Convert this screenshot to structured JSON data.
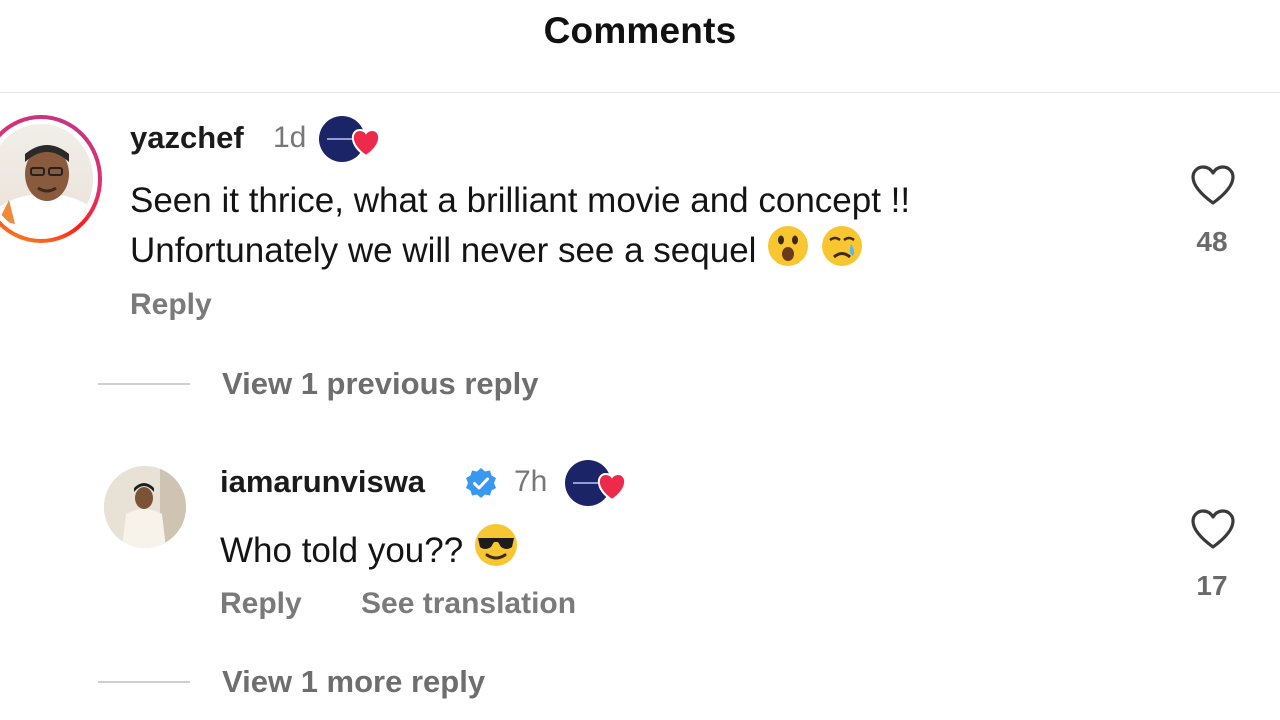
{
  "header": {
    "title": "Comments"
  },
  "comments": [
    {
      "username": "yazchef",
      "time": "1d",
      "line1": "Seen it thrice, what a brilliant movie and concept !!",
      "line2": "Unfortunately we will never see a sequel",
      "emojis": [
        "astonished-face-emoji",
        "crying-face-emoji"
      ],
      "reply_label": "Reply",
      "like_count": "48",
      "view_replies_label": "View 1 previous reply"
    },
    {
      "username": "iamarunviswa",
      "verified": true,
      "time": "7h",
      "text": "Who told you??",
      "emojis": [
        "sunglasses-face-emoji"
      ],
      "reply_label": "Reply",
      "translate_label": "See translation",
      "like_count": "17",
      "view_replies_label": "View 1 more reply"
    }
  ],
  "icons": {
    "like": "heart-outline-icon",
    "creator_liked": "creator-liked-heart-badge",
    "verified": "verified-badge-icon"
  },
  "colors": {
    "story_ring": [
      "#c13584",
      "#e1306c",
      "#fd1d1d",
      "#f5a623"
    ],
    "verified_blue": "#3897f0",
    "heart_red": "#ed2a4b",
    "badge_navy": "#1a2466"
  }
}
